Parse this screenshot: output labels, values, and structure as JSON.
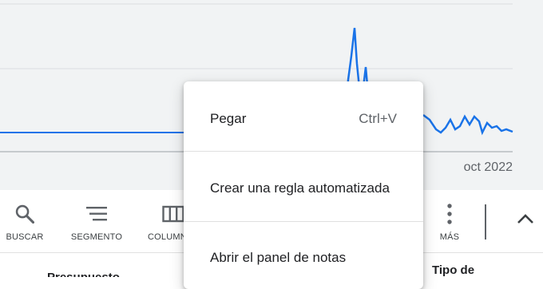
{
  "chart": {
    "x_tick_label": "oct 2022",
    "line_color": "#1a73e8",
    "baseline_color": "#5f6368"
  },
  "toolbar": {
    "items": [
      {
        "label": "BUSCAR",
        "icon": "search-icon"
      },
      {
        "label": "SEGMENTO",
        "icon": "segment-icon"
      },
      {
        "label": "COLUMNAS",
        "icon": "columns-icon"
      },
      {
        "label": "MÁS",
        "icon": "more-vert-icon"
      }
    ],
    "collapse_icon": "chevron-up-icon"
  },
  "table": {
    "headers": [
      "Presupuesto",
      "Tipo de"
    ]
  },
  "context_menu": {
    "items": [
      {
        "label": "Pegar",
        "shortcut": "Ctrl+V"
      },
      {
        "label": "Crear una regla automatizada"
      },
      {
        "label": "Abrir el panel de notas"
      }
    ]
  }
}
